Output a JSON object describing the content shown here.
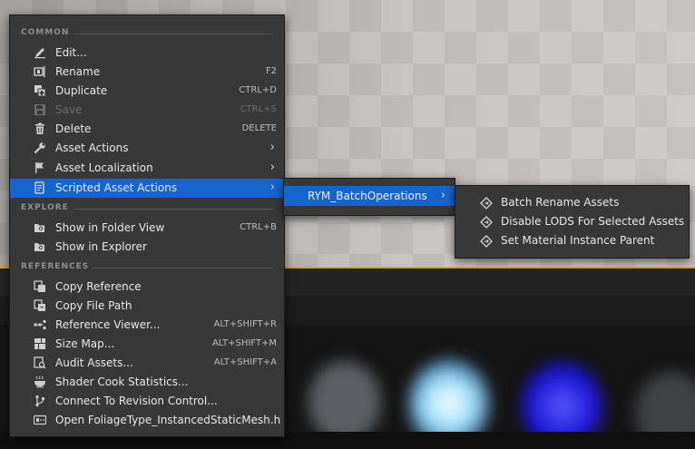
{
  "menu": {
    "sections": {
      "common": "COMMON",
      "explore": "EXPLORE",
      "references": "REFERENCES"
    },
    "items": {
      "edit": {
        "label": "Edit...",
        "shortcut": ""
      },
      "rename": {
        "label": "Rename",
        "shortcut": "F2"
      },
      "duplicate": {
        "label": "Duplicate",
        "shortcut": "CTRL+D"
      },
      "save": {
        "label": "Save",
        "shortcut": "CTRL+S"
      },
      "delete": {
        "label": "Delete",
        "shortcut": "DELETE"
      },
      "asset_actions": {
        "label": "Asset Actions"
      },
      "asset_localization": {
        "label": "Asset Localization"
      },
      "scripted_asset_actions": {
        "label": "Scripted Asset Actions"
      },
      "show_in_folder_view": {
        "label": "Show in Folder View",
        "shortcut": "CTRL+B"
      },
      "show_in_explorer": {
        "label": "Show in Explorer"
      },
      "copy_reference": {
        "label": "Copy Reference"
      },
      "copy_file_path": {
        "label": "Copy File Path"
      },
      "reference_viewer": {
        "label": "Reference Viewer...",
        "shortcut": "ALT+SHIFT+R"
      },
      "size_map": {
        "label": "Size Map...",
        "shortcut": "ALT+SHIFT+M"
      },
      "audit_assets": {
        "label": "Audit Assets...",
        "shortcut": "ALT+SHIFT+A"
      },
      "shader_cook_statistics": {
        "label": "Shader Cook Statistics..."
      },
      "connect_revision_control": {
        "label": "Connect To Revision Control..."
      },
      "open_source": {
        "label": "Open FoliageType_InstancedStaticMesh.h"
      }
    },
    "submenu_arrow": "›"
  },
  "submenu": {
    "label": "RYM_BatchOperations",
    "arrow": "›"
  },
  "submenu2": {
    "items": [
      "Batch Rename Assets",
      "Disable LODS For Selected Assets",
      "Set Material Instance Parent"
    ]
  },
  "colors": {
    "highlight": "#1565d0",
    "menu_bg": "#383838",
    "accent_line": "#e8a01a"
  }
}
